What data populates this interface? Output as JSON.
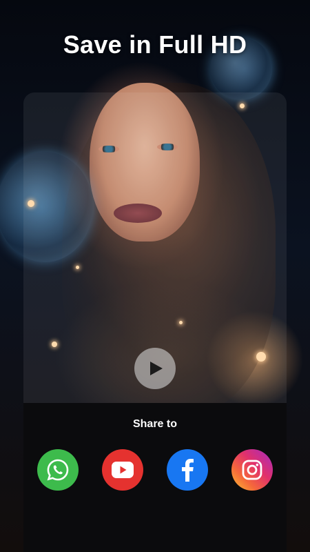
{
  "header": {
    "title": "Save in Full HD"
  },
  "preview": {
    "play_icon": "play-icon"
  },
  "share": {
    "title": "Share to",
    "targets": [
      {
        "name": "WhatsApp",
        "icon": "whatsapp-icon",
        "color": "#3dbb4c"
      },
      {
        "name": "YouTube",
        "icon": "youtube-icon",
        "color": "#e5322f"
      },
      {
        "name": "Facebook",
        "icon": "facebook-icon",
        "color": "#1877f2"
      },
      {
        "name": "Instagram",
        "icon": "instagram-icon",
        "color": "#e1306c"
      }
    ]
  },
  "colors": {
    "sheet_background": "#0b0b0d",
    "play_button": "#d2d2d2"
  }
}
